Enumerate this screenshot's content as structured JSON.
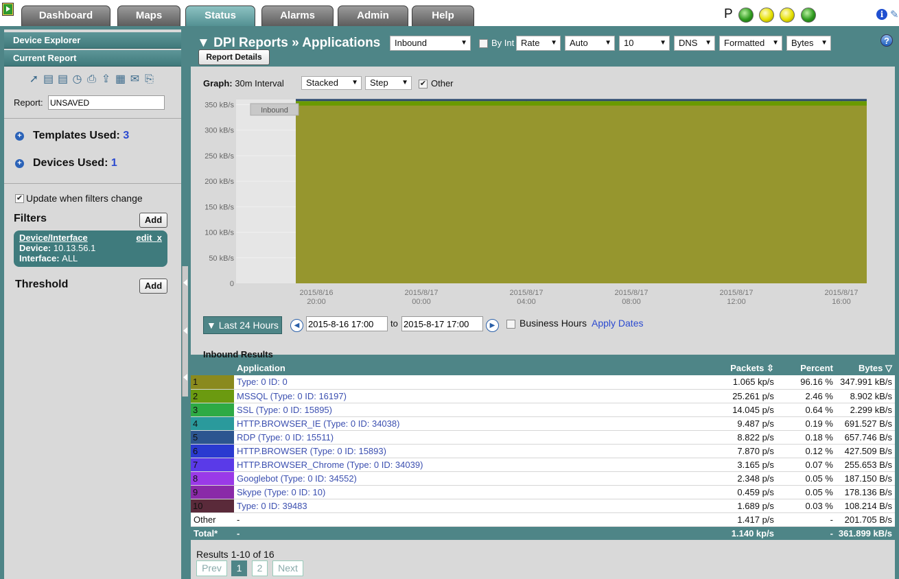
{
  "nav": {
    "tabs": [
      "Dashboard",
      "Maps",
      "Status",
      "Alarms",
      "Admin",
      "Help"
    ],
    "active_tab": "Status",
    "status_letter": "P"
  },
  "sidebar": {
    "device_explorer": "Device Explorer",
    "current_report": "Current Report",
    "tool_icons": [
      "share-icon",
      "save-icon",
      "save-as-icon",
      "schedule-icon",
      "print-icon",
      "export-icon",
      "table-icon",
      "email-icon",
      "pdf-icon"
    ],
    "report_label": "Report:",
    "report_value": "UNSAVED",
    "templates_label": "Templates Used:",
    "templates_count": "3",
    "devices_label": "Devices Used:",
    "devices_count": "1",
    "update_label": "Update when filters change",
    "filters_label": "Filters",
    "add_label": "Add",
    "filter": {
      "title": "Device/Interface",
      "edit": "edit",
      "remove": "x",
      "device_label": "Device:",
      "device_value": "10.13.56.1",
      "interface_label": "Interface:",
      "interface_value": "ALL"
    },
    "threshold_label": "Threshold"
  },
  "header": {
    "title": "▼ DPI Reports » Applications",
    "report_details": "Report Details",
    "direction": "Inbound",
    "by_int": "By Int",
    "rate": "Rate",
    "auto": "Auto",
    "top_n": "10",
    "dns": "DNS",
    "formatted": "Formatted",
    "units": "Bytes"
  },
  "graph": {
    "label": "Graph:",
    "interval": "30m Interval",
    "mode": "Stacked",
    "style": "Step",
    "other": "Other",
    "legend_tag": "Inbound"
  },
  "chart_data": {
    "type": "area",
    "y_ticks": [
      "350 kB/s",
      "300 kB/s",
      "250 kB/s",
      "200 kB/s",
      "150 kB/s",
      "100 kB/s",
      "50 kB/s",
      "0"
    ],
    "x_ticks": [
      {
        "date": "2015/8/16",
        "time": "20:00"
      },
      {
        "date": "2015/8/17",
        "time": "00:00"
      },
      {
        "date": "2015/8/17",
        "time": "04:00"
      },
      {
        "date": "2015/8/17",
        "time": "08:00"
      },
      {
        "date": "2015/8/17",
        "time": "12:00"
      },
      {
        "date": "2015/8/17",
        "time": "16:00"
      }
    ],
    "ylim": [
      0,
      360
    ],
    "series": [
      {
        "name": "Type: 0 ID: 0",
        "color": "#96962e",
        "value": 348
      },
      {
        "name": "MSSQL (Type: 0 ID: 16197)",
        "color": "#6a9a00",
        "value": 8.9
      }
    ]
  },
  "daterange": {
    "preset": "▼ Last 24 Hours",
    "from": "2015-8-16 17:00",
    "to_label": "to",
    "to": "2015-8-17 17:00",
    "business_hours": "Business Hours",
    "apply": "Apply Dates"
  },
  "results": {
    "title": "Inbound Results",
    "columns": {
      "application": "Application",
      "packets": "Packets",
      "percent": "Percent",
      "bytes": "Bytes"
    },
    "rows": [
      {
        "rank": "1",
        "color": "#8a8a1e",
        "app": "Type: 0 ID: 0",
        "packets": "1.065 kp/s",
        "percent": "96.16 %",
        "bytes": "347.991 kB/s"
      },
      {
        "rank": "2",
        "color": "#6b9a10",
        "app": "MSSQL (Type: 0 ID: 16197)",
        "packets": "25.261 p/s",
        "percent": "2.46 %",
        "bytes": "8.902 kB/s"
      },
      {
        "rank": "3",
        "color": "#2eaa44",
        "app": "SSL (Type: 0 ID: 15895)",
        "packets": "14.045 p/s",
        "percent": "0.64 %",
        "bytes": "2.299 kB/s"
      },
      {
        "rank": "4",
        "color": "#2a9a9c",
        "app": "HTTP.BROWSER_IE (Type: 0 ID: 34038)",
        "packets": "9.487 p/s",
        "percent": "0.19 %",
        "bytes": "691.527 B/s"
      },
      {
        "rank": "5",
        "color": "#2c5590",
        "app": "RDP (Type: 0 ID: 15511)",
        "packets": "8.822 p/s",
        "percent": "0.18 %",
        "bytes": "657.746 B/s"
      },
      {
        "rank": "6",
        "color": "#2a3ad0",
        "app": "HTTP.BROWSER (Type: 0 ID: 15893)",
        "packets": "7.870 p/s",
        "percent": "0.12 %",
        "bytes": "427.509 B/s"
      },
      {
        "rank": "7",
        "color": "#5a3ae8",
        "app": "HTTP.BROWSER_Chrome (Type: 0 ID: 34039)",
        "packets": "3.165 p/s",
        "percent": "0.07 %",
        "bytes": "255.653 B/s"
      },
      {
        "rank": "8",
        "color": "#9a3ae8",
        "app": "Googlebot (Type: 0 ID: 34552)",
        "packets": "2.348 p/s",
        "percent": "0.05 %",
        "bytes": "187.150 B/s"
      },
      {
        "rank": "9",
        "color": "#8a2aa8",
        "app": "Skype (Type: 0 ID: 10)",
        "packets": "0.459 p/s",
        "percent": "0.05 %",
        "bytes": "178.136 B/s"
      },
      {
        "rank": "10",
        "color": "#5a2a3a",
        "app": "Type: 0 ID: 39483",
        "packets": "1.689 p/s",
        "percent": "0.03 %",
        "bytes": "108.214 B/s"
      }
    ],
    "other": {
      "label": "Other",
      "app": "-",
      "packets": "1.417 p/s",
      "percent": "-",
      "bytes": "201.705 B/s"
    },
    "total": {
      "label": "Total*",
      "app": "-",
      "packets": "1.140 kp/s",
      "percent": "-",
      "bytes": "361.899 kB/s"
    }
  },
  "pagination": {
    "summary": "Results 1-10 of 16",
    "prev": "Prev",
    "pages": [
      "1",
      "2"
    ],
    "next": "Next"
  }
}
